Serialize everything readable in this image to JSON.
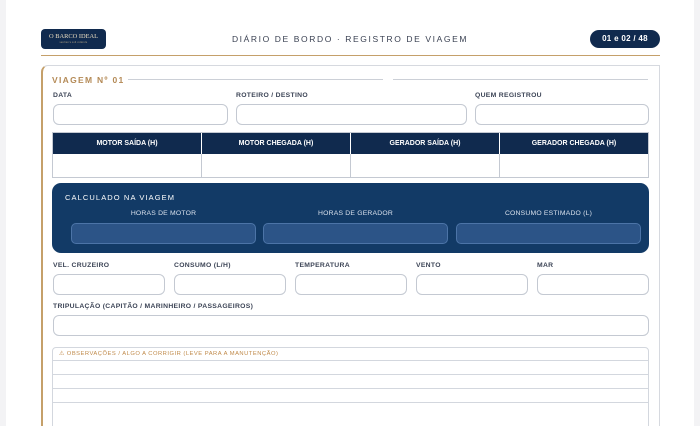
{
  "header": {
    "logo_text": "O BARCO IDEAL",
    "logo_tagline": "seu barco sob controle",
    "title": "DIÁRIO DE BORDO · REGISTRO DE VIAGEM",
    "page_badge": "01 e 02 / 48"
  },
  "voyage": {
    "title": "VIAGEM Nº 01",
    "fields_row1": {
      "date": "DATA",
      "route": "ROTEIRO / DESTINO",
      "recorded_by": "QUEM REGISTROU"
    },
    "hours_table": {
      "headers": [
        "MOTOR SAÍDA (H)",
        "MOTOR CHEGADA (H)",
        "GERADOR SAÍDA (H)",
        "GERADOR CHEGADA (H)"
      ]
    },
    "calculated": {
      "title": "CALCULADO NA VIAGEM",
      "columns": [
        "HORAS DE MOTOR",
        "HORAS DE GERADOR",
        "CONSUMO ESTIMADO (L)"
      ]
    },
    "fields_row2": [
      "VEL. CRUZEIRO",
      "CONSUMO (L/H)",
      "TEMPERATURA",
      "VENTO",
      "MAR"
    ],
    "crew_label": "TRIPULAÇÃO (CAPITÃO / MARINHEIRO / PASSAGEIROS)",
    "observations_label": "⚠ OBSERVAÇÕES / ALGO A CORRIGIR (LEVE PARA A MANUTENÇÃO)"
  },
  "colors": {
    "navy": "#102a4e",
    "gold": "#c5a06a",
    "calc_panel": "#123a66"
  }
}
